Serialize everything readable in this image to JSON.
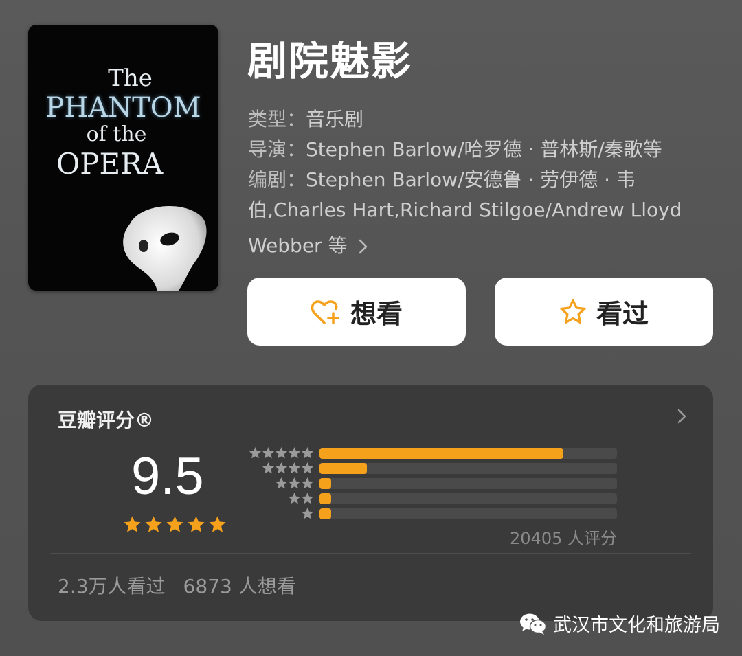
{
  "poster": {
    "line1": "The",
    "line2": "PHANTOM",
    "line3": "of the",
    "line4": "OPERA"
  },
  "title": "剧院魅影",
  "meta": {
    "type_label": "类型：",
    "type_value": "音乐剧",
    "director_label": "导演：",
    "director_value": "Stephen Barlow/哈罗德 · 普林斯/秦歌等",
    "writer_label": "编剧：",
    "writer_value_line1": "Stephen Barlow/安德鲁 · 劳伊德 · 韦",
    "writer_value_line2": "伯,Charles Hart,Richard Stilgoe/Andrew Lloyd",
    "writer_value_line3": "Webber 等"
  },
  "buttons": {
    "want": "想看",
    "seen": "看过"
  },
  "rating": {
    "title": "豆瓣评分®",
    "score": "9.5",
    "count_text": "20405 人评分",
    "distribution": [
      {
        "stars": 5,
        "fraction": 0.82
      },
      {
        "stars": 4,
        "fraction": 0.16
      },
      {
        "stars": 3,
        "fraction": 0.04
      },
      {
        "stars": 2,
        "fraction": 0.04
      },
      {
        "stars": 1,
        "fraction": 0.04
      }
    ],
    "seen_text": "2.3万人看过",
    "want_text": "6873 人想看"
  },
  "watermark": "武汉市文化和旅游局",
  "colors": {
    "accent": "#f5a11c",
    "star_gray": "#9a9a9a"
  }
}
